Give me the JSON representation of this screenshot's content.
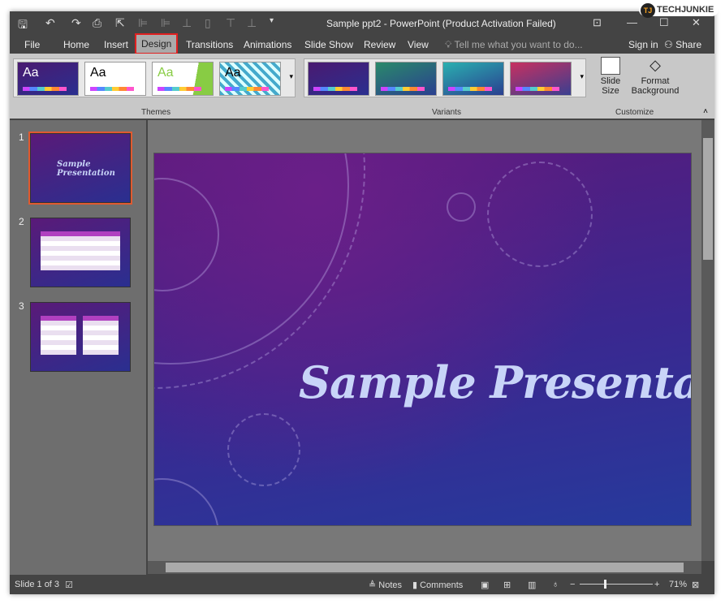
{
  "window": {
    "title": "Sample ppt2 - PowerPoint (Product Activation Failed)",
    "watermark": "TECHJUNKIE"
  },
  "tabs": [
    "File",
    "Home",
    "Insert",
    "Design",
    "Transitions",
    "Animations",
    "Slide Show",
    "Review",
    "View"
  ],
  "tell_me": "Tell me what you want to do...",
  "sign_in": "Sign in",
  "share": "Share",
  "ribbon": {
    "themes_label": "Themes",
    "variants_label": "Variants",
    "customize_label": "Customize",
    "theme_sample": "Aa",
    "slide_size": "Slide Size",
    "format_background": "Format Background"
  },
  "slides": {
    "numbers": [
      "1",
      "2",
      "3"
    ],
    "selected": 1
  },
  "slide": {
    "title": "Sample Presentation"
  },
  "status": {
    "slide": "Slide 1 of 3",
    "notes": "Notes",
    "comments": "Comments",
    "zoom": "71%"
  },
  "colors": {
    "accent_selection": "#e02020",
    "slide_bg": "#4a2490"
  }
}
